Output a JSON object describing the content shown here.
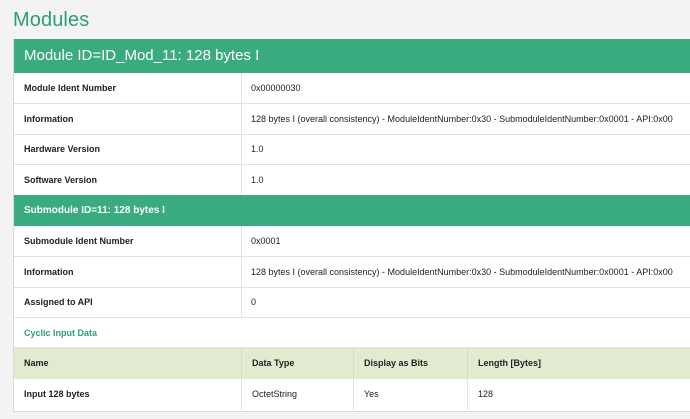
{
  "page": {
    "title": "Modules"
  },
  "module": {
    "header": "Module ID=ID_Mod_11: 128 bytes I",
    "rows": [
      {
        "label": "Module Ident Number",
        "value": "0x00000030"
      },
      {
        "label": "Information",
        "value": "128 bytes I (overall consistency) - ModuleIdentNumber:0x30 - SubmoduleIdentNumber:0x0001 - API:0x00"
      },
      {
        "label": "Hardware Version",
        "value": "1.0"
      },
      {
        "label": "Software Version",
        "value": "1.0"
      }
    ]
  },
  "submodule": {
    "header": "Submodule ID=11: 128 bytes I",
    "rows": [
      {
        "label": "Submodule Ident Number",
        "value": "0x0001"
      },
      {
        "label": "Information",
        "value": "128 bytes I (overall consistency) - ModuleIdentNumber:0x30 - SubmoduleIdentNumber:0x0001 - API:0x00"
      },
      {
        "label": "Assigned to API",
        "value": "0"
      }
    ]
  },
  "cyclic_input": {
    "label": "Cyclic Input Data",
    "columns": [
      "Name",
      "Data Type",
      "Display as Bits",
      "Length [Bytes]"
    ],
    "rows": [
      [
        "Input 128 bytes",
        "OctetString",
        "Yes",
        "128"
      ]
    ]
  },
  "colors": {
    "accent": "#3aaa7f",
    "title": "#2e9e73",
    "table_header_bg": "#e2ebcf"
  }
}
